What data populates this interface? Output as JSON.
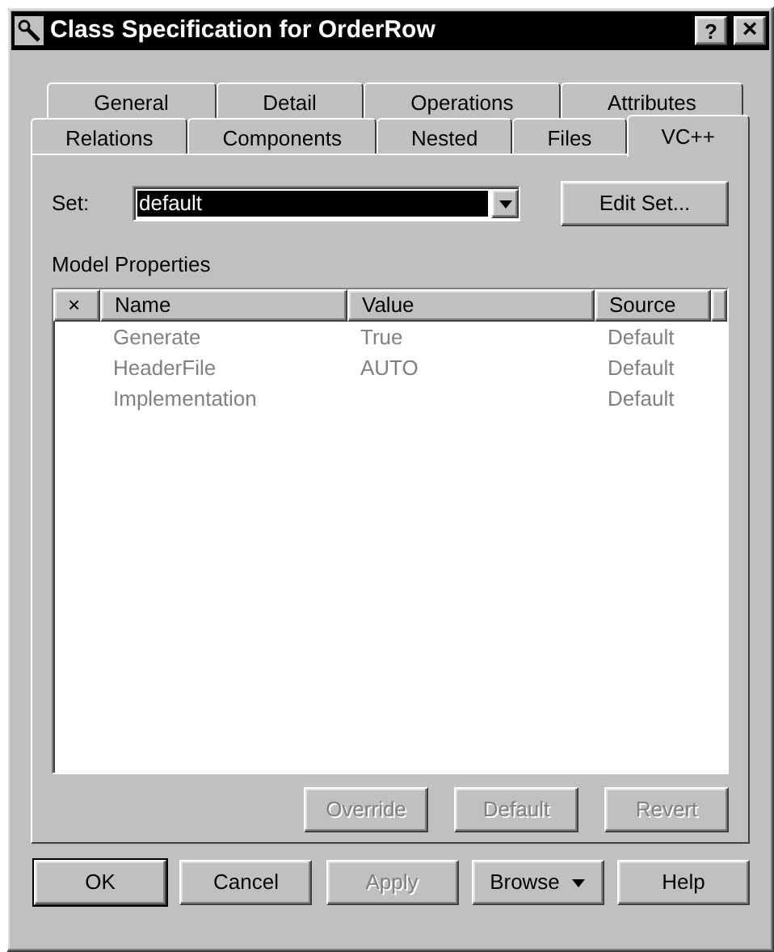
{
  "window": {
    "title": "Class Specification for OrderRow",
    "help_button": "?",
    "close_button": "×"
  },
  "tab_rows": [
    [
      {
        "label": "General",
        "selected": false
      },
      {
        "label": "Detail",
        "selected": false
      },
      {
        "label": "Operations",
        "selected": false
      },
      {
        "label": "Attributes",
        "selected": false
      }
    ],
    [
      {
        "label": "Relations",
        "selected": false
      },
      {
        "label": "Components",
        "selected": false
      },
      {
        "label": "Nested",
        "selected": false
      },
      {
        "label": "Files",
        "selected": false
      },
      {
        "label": "VC++",
        "selected": true
      }
    ]
  ],
  "set": {
    "label": "Set:",
    "value": "default",
    "edit_button": "Edit Set..."
  },
  "properties": {
    "label": "Model Properties",
    "columns": [
      "×",
      "Name",
      "Value",
      "Source"
    ],
    "rows": [
      {
        "name": "Generate",
        "value": "True",
        "source": "Default",
        "disabled": true
      },
      {
        "name": "HeaderFile",
        "value": "AUTO",
        "source": "Default",
        "disabled": true
      },
      {
        "name": "Implementation",
        "source": "Default",
        "disabled": true
      }
    ],
    "buttons": [
      {
        "label": "Override",
        "disabled": true
      },
      {
        "label": "Default",
        "disabled": true
      },
      {
        "label": "Revert",
        "disabled": true
      }
    ]
  },
  "buttons": [
    {
      "label": "OK",
      "disabled": false,
      "default": true,
      "menu": false
    },
    {
      "label": "Cancel",
      "disabled": false,
      "default": false,
      "menu": false
    },
    {
      "label": "Apply",
      "disabled": true,
      "default": false,
      "menu": false
    },
    {
      "label": "Browse",
      "disabled": false,
      "default": false,
      "menu": true
    },
    {
      "label": "Help",
      "disabled": false,
      "default": false,
      "menu": false
    }
  ]
}
